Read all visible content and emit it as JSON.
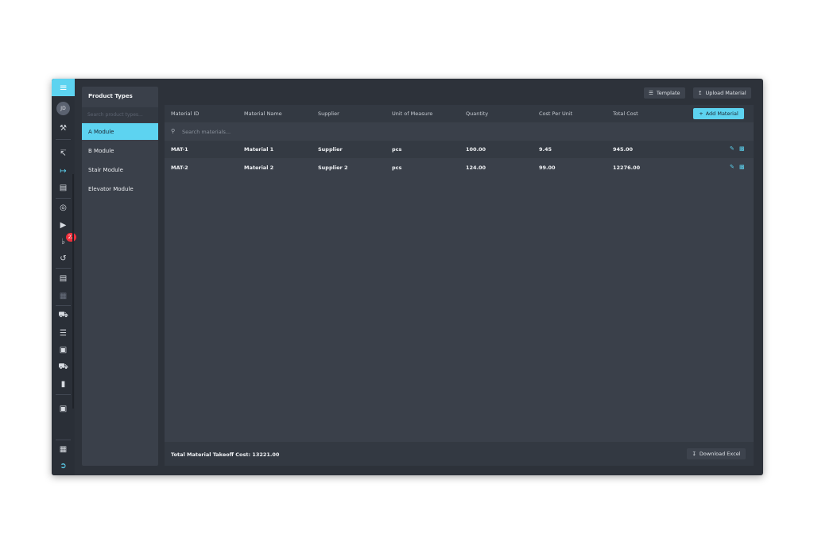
{
  "rail": {
    "logo_icon": "module-logo-icon",
    "avatar_initials": "JD",
    "notifications_count": "22",
    "icons": [
      "wrench-icon",
      "chart-icon",
      "arrow-right-bar-icon",
      "receipt-icon",
      "target-icon",
      "play-icon",
      "bell-icon",
      "history-icon",
      "document-icon",
      "spreadsheet-icon",
      "truck-icon",
      "list-icon",
      "boxes-icon",
      "cart-icon",
      "bar-chart-icon",
      "window-icon",
      "grid-icon",
      "logout-icon"
    ]
  },
  "product_types": {
    "title": "Product Types",
    "search_placeholder": "Search product types...",
    "items": [
      {
        "label": "A Module",
        "active": true
      },
      {
        "label": "B Module",
        "active": false
      },
      {
        "label": "Stair Module",
        "active": false
      },
      {
        "label": "Elevator Module",
        "active": false
      }
    ]
  },
  "toolbar": {
    "template_label": "Template",
    "upload_label": "Upload Material"
  },
  "table": {
    "columns": [
      "Material ID",
      "Material Name",
      "Supplier",
      "Unit of Measure",
      "Quantity",
      "Cost Per Unit",
      "Total Cost"
    ],
    "add_label": "Add Material",
    "search_placeholder": "Search materials...",
    "rows": [
      {
        "id": "MAT-1",
        "name": "Material 1",
        "supplier": "Supplier",
        "unit": "pcs",
        "quantity": "100.00",
        "cost_per_unit": "9.45",
        "total_cost": "945.00"
      },
      {
        "id": "MAT-2",
        "name": "Material 2",
        "supplier": "Supplier 2",
        "unit": "pcs",
        "quantity": "124.00",
        "cost_per_unit": "99.00",
        "total_cost": "12276.00"
      }
    ]
  },
  "footer": {
    "total_label": "Total Material Takeoff Cost: 13221.00",
    "download_label": "Download Excel"
  },
  "colors": {
    "accent": "#5dd3f0",
    "background": "#2d323a",
    "panel": "#3a404a",
    "badge": "#ef2f3b"
  }
}
